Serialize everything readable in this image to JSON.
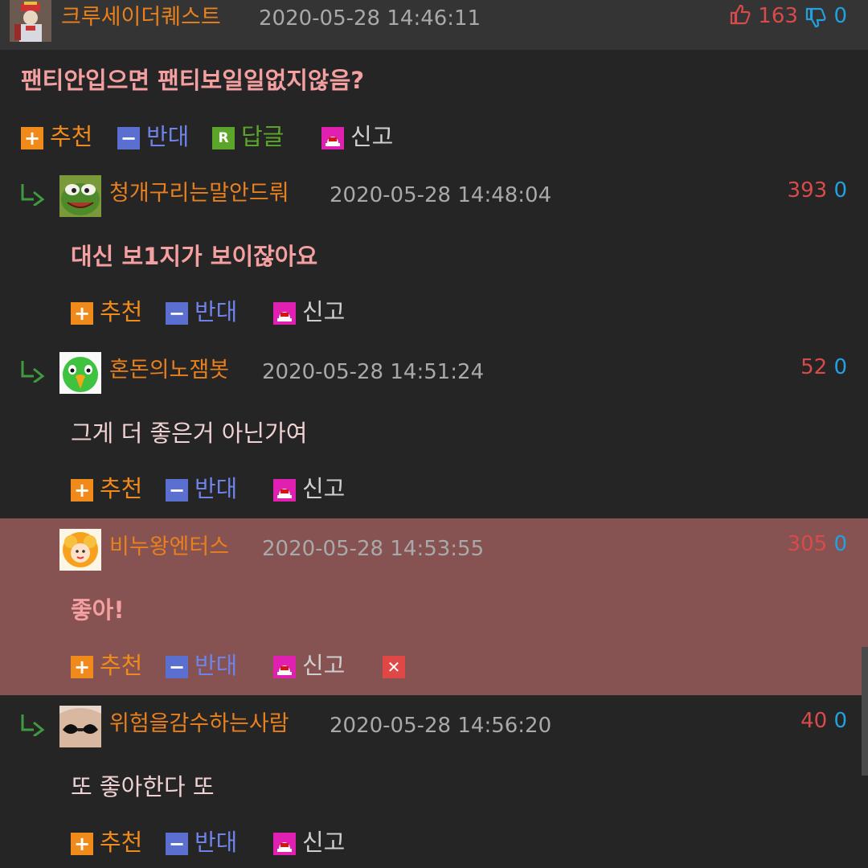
{
  "post": {
    "nickname": "크루세이더퀘스트",
    "date": "2020-05-28 14:46:11",
    "likes": "163",
    "dislikes": "0",
    "body": "팬티안입으면 팬티보일일없지않음?",
    "actions": {
      "recommend": "추천",
      "oppose": "반대",
      "reply": "답글",
      "report": "신고"
    }
  },
  "comments": [
    {
      "nickname": "청개구리는말안드뤄",
      "date": "2020-05-28 14:48:04",
      "likes": "393",
      "dislikes": "0",
      "body": "대신 보1지가 보이잖아요"
    },
    {
      "nickname": "혼돈의노잼봇",
      "date": "2020-05-28 14:51:24",
      "likes": "52",
      "dislikes": "0",
      "body": "그게 더 좋은거 아닌가여"
    },
    {
      "nickname": "비누왕엔터스",
      "date": "2020-05-28 14:53:55",
      "likes": "305",
      "dislikes": "0",
      "body": "좋아!"
    },
    {
      "nickname": "위험을감수하는사람",
      "date": "2020-05-28 14:56:20",
      "likes": "40",
      "dislikes": "0",
      "body": "또 좋아한다 또"
    }
  ],
  "actions": {
    "recommend": "추천",
    "oppose": "반대",
    "report": "신고",
    "delete_icon": "close-icon"
  },
  "colors": {
    "background": "#252525",
    "header": "#343434",
    "highlight": "#865352",
    "nickname": "#e8801e",
    "like": "#d94a4a",
    "dislike": "#22a0e0"
  }
}
